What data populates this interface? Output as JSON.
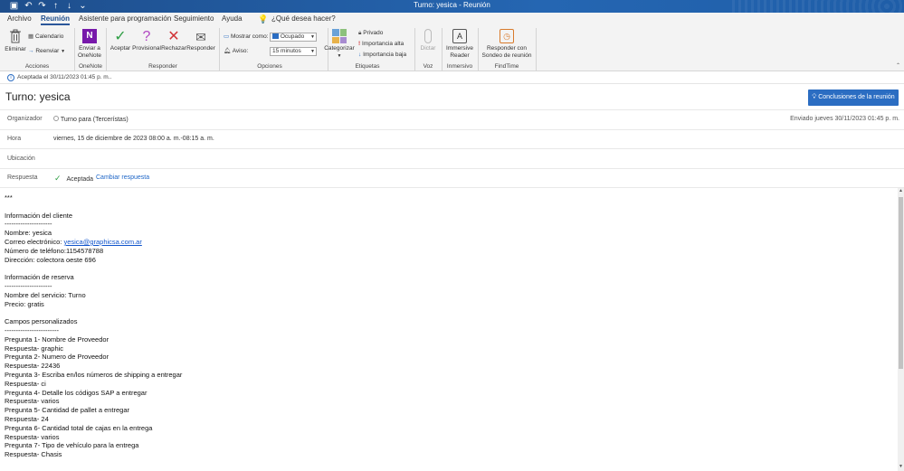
{
  "window": {
    "title": "Turno: yesica  -  Reunión"
  },
  "menu": {
    "tabs": [
      "Archivo",
      "Reunión",
      "Asistente para programación",
      "Seguimiento",
      "Ayuda"
    ],
    "tell_me": "¿Qué desea hacer?"
  },
  "ribbon": {
    "acciones": {
      "eliminar": "Eliminar",
      "calendario": "Calendario",
      "reenviar": "Reenviar",
      "label": "Acciones"
    },
    "onenote": {
      "enviar": "Enviar a OneNote",
      "label": "OneNote"
    },
    "responder": {
      "aceptar": "Aceptar",
      "provisional": "Provisional",
      "rechazar": "Rechazar",
      "responder": "Responder",
      "label": "Responder"
    },
    "opciones": {
      "mostrar_como": "Mostrar como:",
      "mostrar_valor": "Ocupado",
      "aviso": "Aviso:",
      "aviso_valor": "15 minutos",
      "label": "Opciones"
    },
    "etiquetas": {
      "categorizar": "Categorizar",
      "privado": "Privado",
      "imp_alta": "Importancia alta",
      "imp_baja": "Importancia baja",
      "label": "Etiquetas"
    },
    "voz": {
      "dictar": "Dictar",
      "label": "Voz"
    },
    "inmersivo": {
      "reader": "Immersive Reader",
      "label": "Inmersivo"
    },
    "findtime": {
      "responder_sondeo": "Responder con Sondeo de reunión",
      "label": "FindTime"
    }
  },
  "infobar": {
    "text": "Aceptada el 30/11/2023 01:45 p. m.."
  },
  "header": {
    "subject": "Turno: yesica",
    "insights_button": "Conclusiones de la reunión",
    "organizer_label": "Organizador",
    "organizer_value": "Turno para (Tercerístas)",
    "sent": "Enviado   jueves 30/11/2023 01:45 p. m.",
    "time_label": "Hora",
    "time_value": "viernes, 15 de diciembre de 2023 08:00 a. m.-08:15 a. m.",
    "location_label": "Ubicación",
    "response_label": "Respuesta",
    "response_value": "Aceptada",
    "change_response": "Cambiar respuesta"
  },
  "body": {
    "stars": "***",
    "cliente_title": "Información del cliente",
    "cliente_rule": "---------------------",
    "nombre": "Nombre: yesica",
    "correo_label": "Correo electrónico: ",
    "correo_link": "yesica@graphicsa.com.ar",
    "telefono": "Número de teléfono:1154578788",
    "direccion": "Dirección: colectora oeste 696",
    "reserva_title": "Información de reserva",
    "reserva_rule": "---------------------",
    "servicio": "Nombre del servicio: Turno",
    "precio": "Precio: gratis",
    "campos_title": "Campos personalizados",
    "campos_rule": "------------------------",
    "qa": [
      "Pregunta 1- Nombre de Proveedor",
      "Respuesta- graphic",
      "Pregunta 2- Numero de Proveedor",
      "Respuesta- 22436",
      "Pregunta 3- Escriba en/los números de shipping a entregar",
      "Respuesta- ci",
      "Pregunta 4- Detalle los códigos SAP a entregar",
      "Respuesta- varios",
      "Pregunta 5- Cantidad de pallet a entregar",
      "Respuesta- 24",
      "Pregunta 6- Cantidad total de cajas en la entrega",
      "Respuesta- varios",
      "Pregunta 7- Tipo de vehículo para la entrega",
      "Respuesta- Chasis"
    ]
  }
}
